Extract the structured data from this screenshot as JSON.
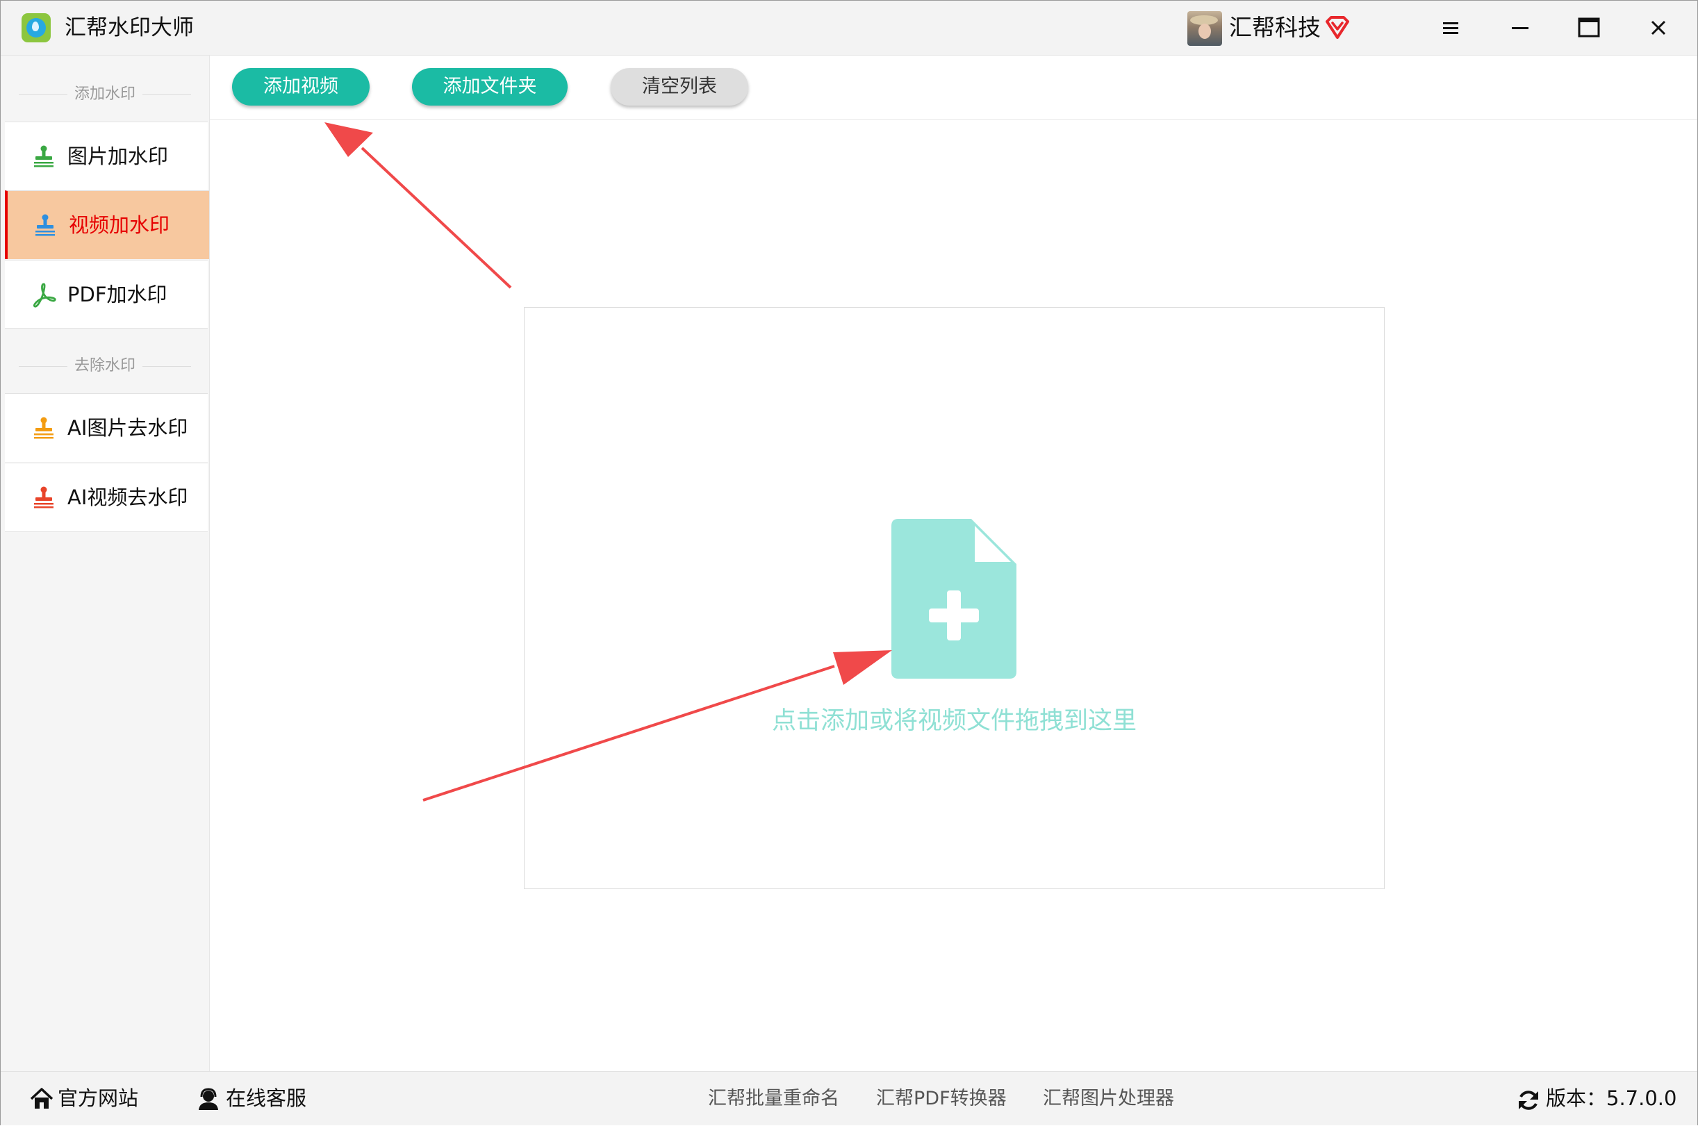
{
  "app": {
    "title": "汇帮水印大师",
    "user_name": "汇帮科技"
  },
  "window_controls": {
    "menu_icon": "hamburger-menu-icon",
    "minimize_icon": "minimize-icon",
    "maximize_icon": "maximize-icon",
    "close_icon": "close-icon"
  },
  "sidebar": {
    "section_add": "添加水印",
    "section_remove": "去除水印",
    "items": [
      {
        "label": "图片加水印",
        "icon": "stamp-icon",
        "color": "#3aa843",
        "active": false
      },
      {
        "label": "视频加水印",
        "icon": "stamp-icon",
        "color": "#2d8fe0",
        "active": true
      },
      {
        "label": "PDF加水印",
        "icon": "pdf-icon",
        "color": "#3aa843",
        "active": false
      },
      {
        "label": "AI图片去水印",
        "icon": "stamp-icon",
        "color": "#f39c12",
        "active": false
      },
      {
        "label": "AI视频去水印",
        "icon": "stamp-icon",
        "color": "#e8442a",
        "active": false
      }
    ]
  },
  "toolbar": {
    "add_video": "添加视频",
    "add_folder": "添加文件夹",
    "clear_list": "清空列表"
  },
  "dropzone": {
    "hint": "点击添加或将视频文件拖拽到这里",
    "icon": "file-add-icon",
    "color": "#9be6dc"
  },
  "footer": {
    "official_site": "官方网站",
    "online_service": "在线客服",
    "products": [
      "汇帮批量重命名",
      "汇帮PDF转换器",
      "汇帮图片处理器"
    ],
    "version": "版本：5.7.0.0"
  },
  "colors": {
    "accent": "#1bbba4",
    "active_bg": "#f7c89f",
    "active_text": "#e60000",
    "annotation_arrow": "#f0494a"
  }
}
